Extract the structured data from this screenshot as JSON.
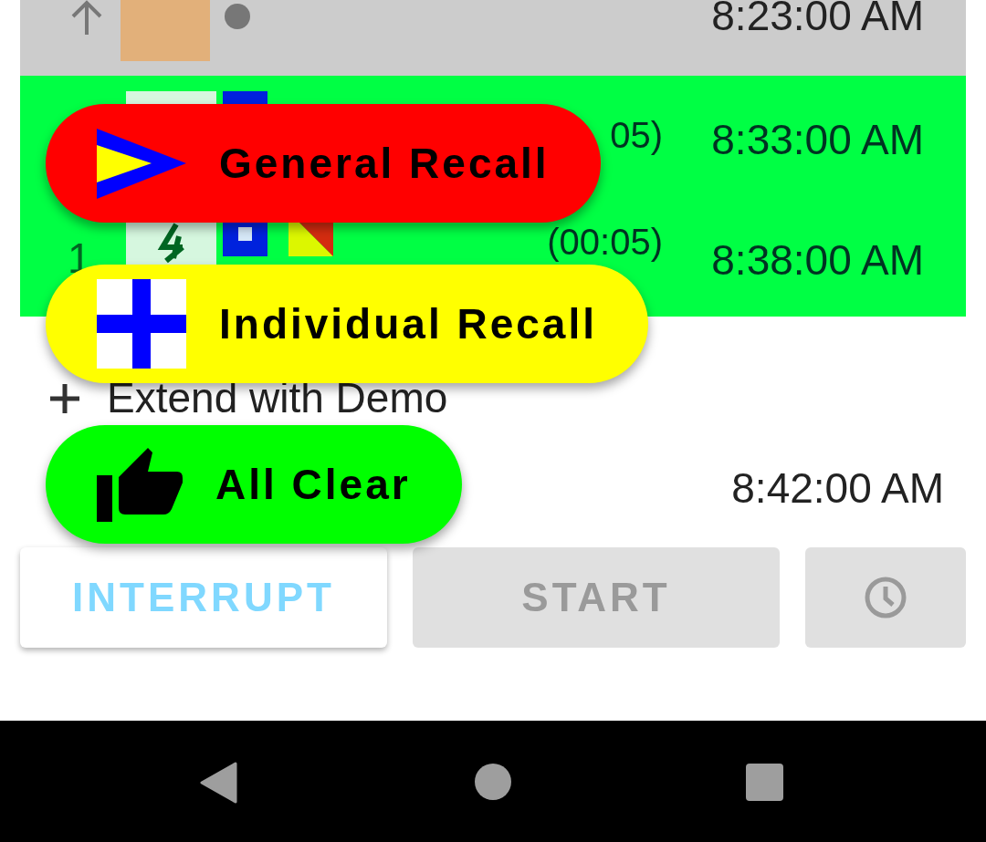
{
  "rows": [
    {
      "kind": "finished",
      "time": "8:23:00 AM"
    },
    {
      "kind": "active",
      "duration": "05)",
      "time": "8:33:00 AM"
    },
    {
      "kind": "active",
      "number": "1",
      "duration": "(00:05)",
      "time": "8:38:00 AM"
    }
  ],
  "extend": {
    "label": "Extend with Demo"
  },
  "end_time": "8:42:00 AM",
  "speed_dial": [
    {
      "kind": "general",
      "label": "General Recall",
      "color": "#ff0000"
    },
    {
      "kind": "individual",
      "label": "Individual Recall",
      "color": "#ffff00"
    },
    {
      "kind": "clear",
      "label": "All Clear",
      "color": "#00ff00"
    }
  ],
  "buttons": [
    {
      "kind": "text",
      "label": "INTERRUPT",
      "disabled": false
    },
    {
      "kind": "text",
      "label": "START",
      "disabled": true
    },
    {
      "kind": "clock",
      "disabled": true
    }
  ]
}
